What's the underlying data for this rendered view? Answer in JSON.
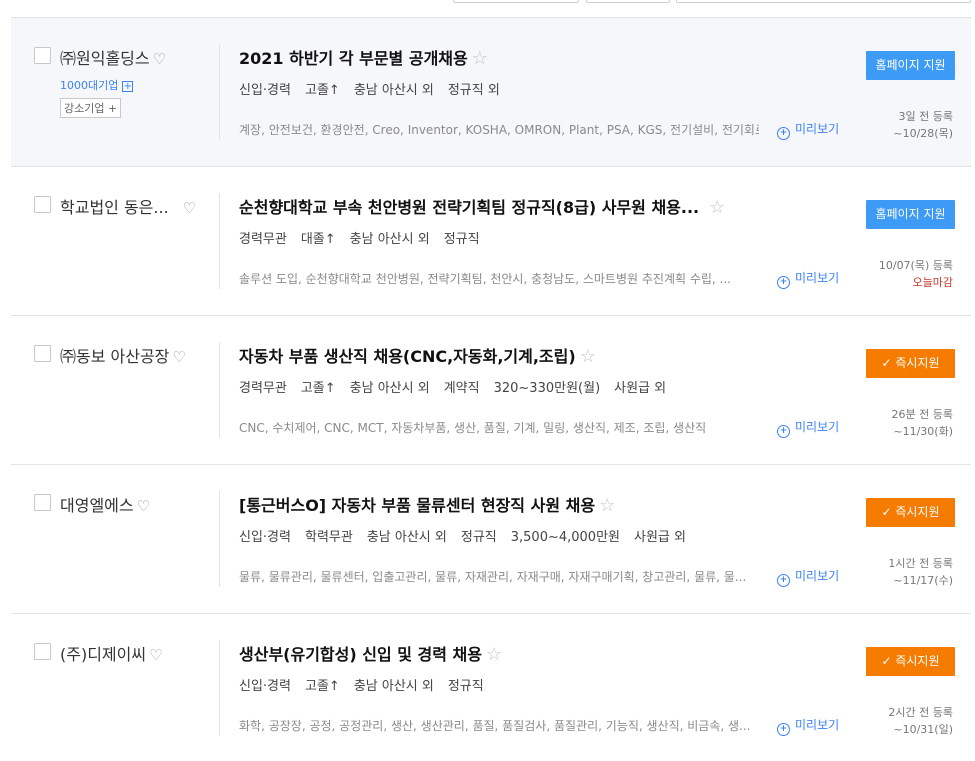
{
  "jobs": [
    {
      "company": "㈜원익홀딩스",
      "badge_1000": "1000대기업",
      "badge_gang": "강소기업 +",
      "title": "2021 하반기 각 부문별 공개채용",
      "conditions": [
        "신입·경력",
        "고졸↑",
        "충남 아산시 외",
        "정규직 외"
      ],
      "keywords": "계장, 안전보건, 환경안전, Creo, Inventor, KOSHA, OMRON, Plant, PSA, KGS, 전기설비, 전기회로, 전...",
      "preview": "미리보기",
      "button": "홈페이지 지원",
      "button_type": "home",
      "registered": "3일 전 등록",
      "deadline": "~10/28(목)"
    },
    {
      "company": "학교법인 동은...",
      "title": "순천향대학교 부속 천안병원 전략기획팀 정규직(8급) 사무원 채용...",
      "conditions": [
        "경력무관",
        "대졸↑",
        "충남 아산시 외",
        "정규직"
      ],
      "keywords": "솔루션 도입, 순천향대학교 천안병원, 전략기획팀, 천안시, 충청남도, 스마트병원 추진계획 수립, ...",
      "preview": "미리보기",
      "button": "홈페이지 지원",
      "button_type": "home",
      "registered": "10/07(목) 등록",
      "deadline": "오늘마감"
    },
    {
      "company": "㈜동보 아산공장",
      "title": "자동차 부품 생산직 채용(CNC,자동화,기계,조립)",
      "conditions": [
        "경력무관",
        "고졸↑",
        "충남 아산시 외",
        "계약직",
        "320~330만원(월)",
        "사원급 외"
      ],
      "keywords": "CNC, 수치제어, CNC, MCT, 자동차부품, 생산, 품질, 기계, 밀링, 생산직, 제조, 조립, 생산직",
      "preview": "미리보기",
      "button": "✓ 즉시지원",
      "button_type": "apply",
      "registered": "26분 전 등록",
      "deadline": "~11/30(화)"
    },
    {
      "company": "대영엘에스",
      "title": "[통근버스O] 자동차 부품 물류센터 현장직 사원 채용",
      "conditions": [
        "신입·경력",
        "학력무관",
        "충남 아산시 외",
        "정규직",
        "3,500~4,000만원",
        "사원급 외"
      ],
      "keywords": "물류, 물류관리, 물류센터, 입출고관리, 물류, 자재관리, 자재구매, 자재구매기획, 창고관리, 물류, 물...",
      "preview": "미리보기",
      "button": "✓ 즉시지원",
      "button_type": "apply",
      "registered": "1시간 전 등록",
      "deadline": "~11/17(수)"
    },
    {
      "company": "(주)디제이씨",
      "title": "생산부(유기합성) 신입 및 경력 채용",
      "conditions": [
        "신입·경력",
        "고졸↑",
        "충남 아산시 외",
        "정규직"
      ],
      "keywords": "화학, 공장장, 공정, 공정관리, 생산, 생산관리, 품질, 품질검사, 품질관리, 기능직, 생산직, 비금속, 생...",
      "preview": "미리보기",
      "button": "✓ 즉시지원",
      "button_type": "apply",
      "registered": "2시간 전 등록",
      "deadline": "~10/31(일)"
    }
  ]
}
